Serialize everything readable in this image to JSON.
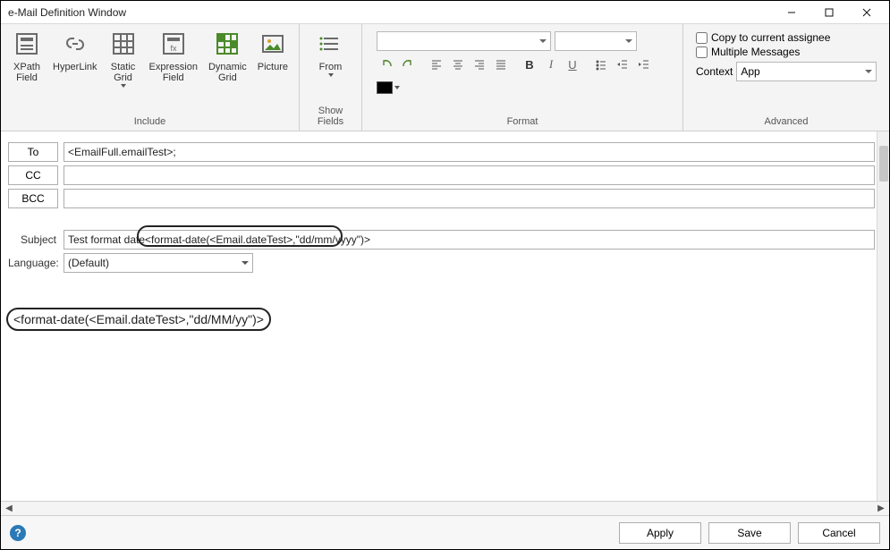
{
  "window": {
    "title": "e-Mail Definition Window"
  },
  "ribbon": {
    "groups": {
      "include": {
        "caption": "Include",
        "buttons": {
          "xpath": "XPath\nField",
          "hyperlink": "HyperLink",
          "staticgrid": "Static\nGrid",
          "exprfield": "Expression\nField",
          "dyngrid": "Dynamic\nGrid",
          "picture": "Picture"
        }
      },
      "showfields": {
        "caption": "Show Fields",
        "buttons": {
          "from": "From"
        }
      },
      "format": {
        "caption": "Format"
      },
      "advanced": {
        "caption": "Advanced",
        "checks": {
          "copy_assignee": "Copy to current assignee",
          "multi_msg": "Multiple Messages"
        },
        "context_label": "Context",
        "context_value": "App"
      }
    }
  },
  "form": {
    "labels": {
      "to": "To",
      "cc": "CC",
      "bcc": "BCC",
      "subject": "Subject",
      "language": "Language:"
    },
    "values": {
      "to": "<EmailFull.emailTest>;",
      "cc": "",
      "bcc": "",
      "subject_prefix": "Test format date",
      "subject_formula": "<format-date(<Email.dateTest>,\"dd/mm/yyyy\")>",
      "language": "(Default)"
    },
    "body_formula": "<format-date(<Email.dateTest>,\"dd/MM/yy\")>"
  },
  "footer": {
    "apply": "Apply",
    "save": "Save",
    "cancel": "Cancel"
  }
}
